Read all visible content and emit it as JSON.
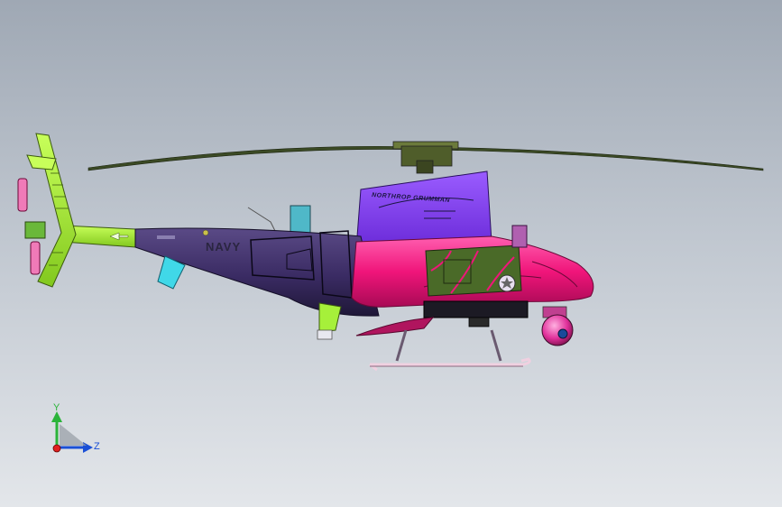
{
  "model": {
    "brand_text": "NORTHROP GRUMMAN",
    "fuselage_text": "NAVY"
  },
  "triad": {
    "y_label": "Y",
    "z_label": "Z",
    "y_color": "#2bb43a",
    "z_color": "#1a4fd6",
    "x_color": "#e02020"
  },
  "colors": {
    "tail": "#a6f03a",
    "fuselage": "#3f2f6a",
    "nose": "#f0157a",
    "cowling": "#8a3ff0",
    "rotor": "#3b4a25",
    "cyan_fin": "#40d8e8"
  }
}
